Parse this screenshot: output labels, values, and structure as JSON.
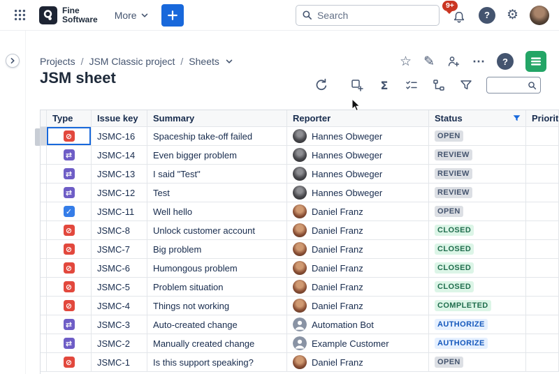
{
  "icons": {
    "gear": "⚙",
    "help": "?",
    "star": "☆",
    "pencil": "✎",
    "ellipsis": "⋯",
    "sum": "Σ"
  },
  "topbar": {
    "icon_names": [
      "app-switcher",
      "logo",
      "plus",
      "search",
      "bell",
      "help",
      "gear",
      "avatar"
    ],
    "logo": {
      "line1": "Fine",
      "line2": "Software"
    },
    "more_label": "More",
    "search_placeholder": "Search",
    "notification_badge": "9+"
  },
  "breadcrumb": {
    "items": [
      "Projects",
      "JSM Classic project",
      "Sheets"
    ],
    "separator": "/"
  },
  "page": {
    "title": "JSM sheet",
    "action_icon_names": [
      "favorite-star",
      "edit-pencil",
      "share",
      "more-options",
      "help",
      "sheets-app"
    ]
  },
  "toolbar": {
    "icon_names": [
      "refresh",
      "add-view",
      "sum",
      "checklist",
      "hierarchy",
      "filter",
      "sheet-search"
    ]
  },
  "table": {
    "headers": {
      "type": "Type",
      "issue_key": "Issue key",
      "summary": "Summary",
      "reporter": "Reporter",
      "status": "Status",
      "priority": "Priority"
    },
    "rows": [
      {
        "type": "incident",
        "key": "JSMC-16",
        "summary": "Spaceship take-off failed",
        "reporter": "Hannes Obweger",
        "avatar": "hannes",
        "status": "OPEN",
        "selected": true
      },
      {
        "type": "change",
        "key": "JSMC-14",
        "summary": "Even bigger problem",
        "reporter": "Hannes Obweger",
        "avatar": "hannes",
        "status": "REVIEW"
      },
      {
        "type": "change",
        "key": "JSMC-13",
        "summary": "I said \"Test\"",
        "reporter": "Hannes Obweger",
        "avatar": "hannes",
        "status": "REVIEW"
      },
      {
        "type": "change",
        "key": "JSMC-12",
        "summary": "Test",
        "reporter": "Hannes Obweger",
        "avatar": "hannes",
        "status": "REVIEW"
      },
      {
        "type": "task",
        "key": "JSMC-11",
        "summary": "Well hello",
        "reporter": "Daniel Franz",
        "avatar": "daniel",
        "status": "OPEN"
      },
      {
        "type": "incident",
        "key": "JSMC-8",
        "summary": "Unlock customer account",
        "reporter": "Daniel Franz",
        "avatar": "daniel",
        "status": "CLOSED"
      },
      {
        "type": "incident",
        "key": "JSMC-7",
        "summary": "Big problem",
        "reporter": "Daniel Franz",
        "avatar": "daniel",
        "status": "CLOSED"
      },
      {
        "type": "incident",
        "key": "JSMC-6",
        "summary": "Humongous problem",
        "reporter": "Daniel Franz",
        "avatar": "daniel",
        "status": "CLOSED"
      },
      {
        "type": "incident",
        "key": "JSMC-5",
        "summary": "Problem situation",
        "reporter": "Daniel Franz",
        "avatar": "daniel",
        "status": "CLOSED"
      },
      {
        "type": "incident",
        "key": "JSMC-4",
        "summary": "Things not working",
        "reporter": "Daniel Franz",
        "avatar": "daniel",
        "status": "COMPLETED"
      },
      {
        "type": "change",
        "key": "JSMC-3",
        "summary": "Auto-created change",
        "reporter": "Automation Bot",
        "avatar": "generic",
        "status": "AUTHORIZE"
      },
      {
        "type": "change",
        "key": "JSMC-2",
        "summary": "Manually created change",
        "reporter": "Example Customer",
        "avatar": "generic",
        "status": "AUTHORIZE"
      },
      {
        "type": "incident",
        "key": "JSMC-1",
        "summary": "Is this support speaking?",
        "reporter": "Daniel Franz",
        "avatar": "daniel",
        "status": "OPEN"
      }
    ]
  },
  "type_icons": {
    "incident": {
      "color": "#E2483D",
      "glyph": "⊘"
    },
    "change": {
      "color": "#6E5DC6",
      "glyph": "⇄"
    },
    "task": {
      "color": "#357DE8",
      "glyph": "✓"
    }
  },
  "status_styles": {
    "OPEN": "neutral",
    "REVIEW": "neutral",
    "CLOSED": "success",
    "COMPLETED": "success",
    "AUTHORIZE": "info"
  },
  "colors": {
    "accent_blue": "#1868DB",
    "notification_red": "#CA3521",
    "sheets_green": "#23A566",
    "lozenge_neutral_bg": "#DCDFE4",
    "lozenge_neutral_text": "#44546E",
    "lozenge_success_bg": "#DCF5E7",
    "lozenge_success_text": "#216E4E",
    "lozenge_info_bg": "#E5F0FF",
    "lozenge_info_text": "#1558BC"
  }
}
